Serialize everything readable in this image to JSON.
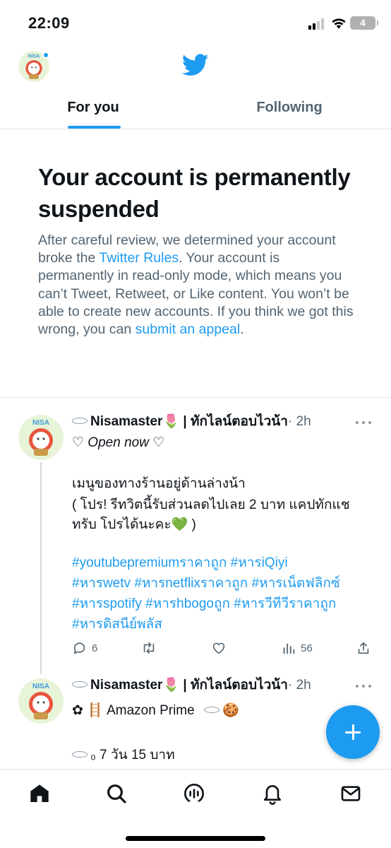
{
  "status_bar": {
    "time": "22:09",
    "battery": "4"
  },
  "header": {
    "logo_icon": "twitter-bird-icon",
    "accent": "#1d9bf0"
  },
  "tabs": [
    {
      "label": "For you",
      "active": true
    },
    {
      "label": "Following",
      "active": false
    }
  ],
  "notice": {
    "title": "Your account is permanently suspended",
    "body_part1": "After careful review, we determined your account broke the ",
    "rules_link": "Twitter Rules",
    "body_part2": ". Your account is permanently in read-only mode, which means you can’t Tweet, Retweet, or Like content. You won’t be able to create new accounts. If you think we got this wrong, you can ",
    "appeal_link": "submit an appeal",
    "body_part3": "."
  },
  "tweets": [
    {
      "name": "Nisamaster🌷",
      "handle_suffix": " | ทักไลน์ตอบไวน้า",
      "time": "· 2h",
      "line1": "♡ Open now ♡",
      "line2": "เมนูของทางร้านอยู่ด้านล่างน้า",
      "line3": "( โปร! รีทวิตนี้รับส่วนลดไปเลย 2 บาท แคปทักแช",
      "line4": "ทรับ โปรได้นะคะ💚 )",
      "hashtags": [
        "#youtubepremiumราคาถูก",
        "#หารiQiyi",
        "#หารwetv",
        "#หารnetflixราคาถูก",
        "#หารเน็ตฟลิกซ์",
        "#หารspotify",
        "#หารhbogoถูก",
        "#หารวีทีวีราคาถูก",
        "#หารดิสนีย์พลัส"
      ],
      "replies": "6",
      "retweets": "",
      "likes": "",
      "views": "56"
    },
    {
      "name": "Nisamaster🌷",
      "handle_suffix": " | ทักไลน์ตอบไวน้า",
      "time": "· 2h",
      "line1": "✿ 🪜  Amazon Prime",
      "line1_end": "🍪",
      "line2": "₀ 7 วัน 15 บาท"
    }
  ],
  "nav": [
    "home-icon",
    "search-icon",
    "spaces-icon",
    "notifications-icon",
    "messages-icon"
  ]
}
